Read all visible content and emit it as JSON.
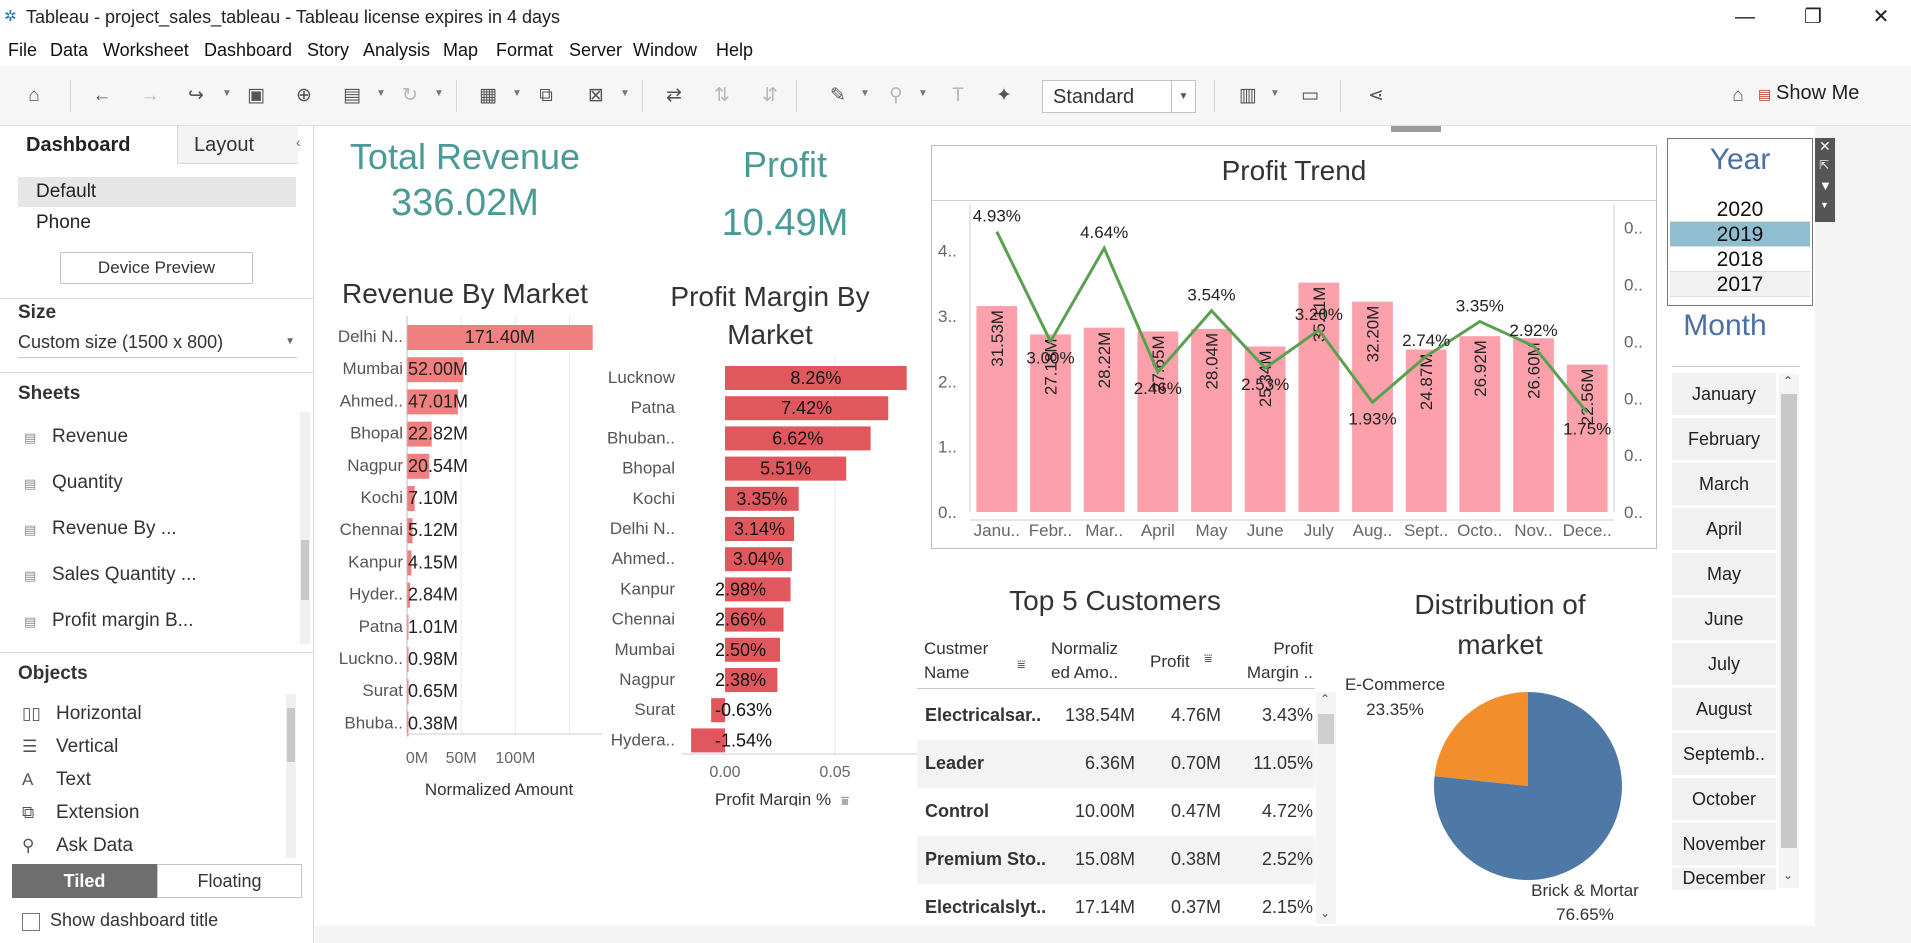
{
  "window": {
    "title": "Tableau - project_sales_tableau - Tableau license expires in 4 days",
    "minimize": "—",
    "restore": "❐",
    "close": "✕"
  },
  "menu": [
    "File",
    "Data",
    "Worksheet",
    "Dashboard",
    "Story",
    "Analysis",
    "Map",
    "Format",
    "Server",
    "Window",
    "Help"
  ],
  "toolbar": {
    "fit_mode": "Standard",
    "show_me": "Show Me"
  },
  "left_pane": {
    "tabs": {
      "dashboard": "Dashboard",
      "layout": "Layout"
    },
    "devices": [
      "Default",
      "Phone"
    ],
    "device_preview": "Device Preview",
    "size_header": "Size",
    "size_value": "Custom size (1500 x 800)",
    "sheets_header": "Sheets",
    "sheets": [
      "Revenue",
      "Quantity",
      "Revenue By ...",
      "Sales Quantity ...",
      "Profit margin B..."
    ],
    "objects_header": "Objects",
    "objects": [
      "Horizontal",
      "Vertical",
      "Text",
      "Extension",
      "Ask Data"
    ],
    "tiled": "Tiled",
    "floating": "Floating",
    "show_title": "Show dashboard title"
  },
  "kpis": {
    "total_revenue_label": "Total Revenue",
    "total_revenue_value": "336.02M",
    "profit_label": "Profit",
    "profit_value": "10.49M"
  },
  "titles": {
    "revenue_by_market": "Revenue By Market",
    "profit_margin_line1": "Profit Margin By",
    "profit_margin_line2": "Market",
    "profit_trend": "Profit Trend",
    "top_customers": "Top 5 Customers",
    "distribution_line1": "Distribution of",
    "distribution_line2": "market"
  },
  "customers_table": {
    "headers": {
      "name_1": "Custmer",
      "name_2": "Name",
      "amount_1": "Normaliz",
      "amount_2": "ed Amo..",
      "profit": "Profit",
      "margin_1": "Profit",
      "margin_2": "Margin .."
    },
    "rows": [
      {
        "name": "Electricalsar..",
        "amount": "138.54M",
        "profit": "4.76M",
        "margin": "3.43%"
      },
      {
        "name": "Leader",
        "amount": "6.36M",
        "profit": "0.70M",
        "margin": "11.05%"
      },
      {
        "name": "Control",
        "amount": "10.00M",
        "profit": "0.47M",
        "margin": "4.72%"
      },
      {
        "name": "Premium Sto..",
        "amount": "15.08M",
        "profit": "0.38M",
        "margin": "2.52%"
      },
      {
        "name": "Electricalslyt..",
        "amount": "17.14M",
        "profit": "0.37M",
        "margin": "2.15%"
      }
    ]
  },
  "filters": {
    "year_title": "Year",
    "years": [
      "2020",
      "2019",
      "2018",
      "2017"
    ],
    "year_selected": "2019",
    "month_title": "Month",
    "months": [
      "January",
      "February",
      "March",
      "April",
      "May",
      "June",
      "July",
      "August",
      "Septemb..",
      "October",
      "November",
      "December"
    ]
  },
  "colors": {
    "kpi": "#4a9a96",
    "revenue_bar": "#f08080",
    "margin_bar": "#e0575e",
    "trend_bar": "#fca1ab",
    "trend_line": "#59a14f",
    "pie_ecommerce": "#f28e2b",
    "pie_brick": "#4e79a7",
    "year_selected": "#8fbfcf"
  },
  "chart_data": [
    {
      "type": "bar",
      "orientation": "horizontal",
      "title": "Revenue By Market",
      "xlabel": "Normalized Amount",
      "x_ticks": [
        "0M",
        "50M",
        "100M"
      ],
      "categories": [
        "Delhi N..",
        "Mumbai",
        "Ahmed..",
        "Bhopal",
        "Nagpur",
        "Kochi",
        "Chennai",
        "Kanpur",
        "Hyder..",
        "Patna",
        "Luckno..",
        "Surat",
        "Bhuba.."
      ],
      "values": [
        171.4,
        52.0,
        47.01,
        22.82,
        20.54,
        7.1,
        5.12,
        4.15,
        2.84,
        1.01,
        0.98,
        0.65,
        0.38
      ],
      "labels": [
        "171.40M",
        "52.00M",
        "47.01M",
        "22.82M",
        "20.54M",
        "7.10M",
        "5.12M",
        "4.15M",
        "2.84M",
        "1.01M",
        "0.98M",
        "0.65M",
        "0.38M"
      ],
      "xlim": [
        0,
        180
      ]
    },
    {
      "type": "bar",
      "orientation": "horizontal",
      "title": "Profit Margin By Market",
      "xlabel": "Profit Margin %",
      "x_ticks": [
        "0.00",
        "0.05"
      ],
      "categories": [
        "Lucknow",
        "Patna",
        "Bhuban..",
        "Bhopal",
        "Kochi",
        "Delhi N..",
        "Ahmed..",
        "Kanpur",
        "Chennai",
        "Mumbai",
        "Nagpur",
        "Surat",
        "Hydera.."
      ],
      "values": [
        0.0826,
        0.0742,
        0.0662,
        0.0551,
        0.0335,
        0.0314,
        0.0304,
        0.0298,
        0.0266,
        0.025,
        0.0238,
        -0.0063,
        -0.0154
      ],
      "labels": [
        "8.26%",
        "7.42%",
        "6.62%",
        "5.51%",
        "3.35%",
        "3.14%",
        "3.04%",
        "2.98%",
        "2.66%",
        "2.50%",
        "2.38%",
        "-0.63%",
        "-1.54%"
      ],
      "xlim": [
        -0.02,
        0.09
      ]
    },
    {
      "type": "bar",
      "title": "Profit Trend",
      "categories": [
        "Janu..",
        "Febr..",
        "Mar..",
        "April",
        "May",
        "June",
        "July",
        "Aug..",
        "Sept..",
        "Octo..",
        "Nov..",
        "Dece.."
      ],
      "y_ticks": [
        "0..",
        "1..",
        "2..",
        "3..",
        "4.."
      ],
      "y2_ticks": [
        "0..",
        "0..",
        "0..",
        "0..",
        "0..",
        "0.."
      ],
      "series": [
        {
          "type": "bar",
          "values": [
            31.53,
            27.18,
            28.22,
            27.65,
            28.04,
            25.34,
            35.11,
            32.2,
            24.87,
            26.92,
            26.6,
            22.56
          ],
          "labels": [
            "31.53M",
            "27.18M",
            "28.22M",
            "27.65M",
            "28.04M",
            "25.34M",
            "35.11M",
            "32.20M",
            "24.87M",
            "26.92M",
            "26.60M",
            "22.56M"
          ]
        },
        {
          "type": "line",
          "values": [
            4.93,
            3.0,
            4.64,
            2.46,
            3.54,
            2.53,
            3.2,
            1.93,
            2.74,
            3.35,
            2.92,
            1.75
          ],
          "labels": [
            "4.93%",
            "3.00%",
            "4.64%",
            "2.46%",
            "3.54%",
            "2.53%",
            "3.20%",
            "1.93%",
            "2.74%",
            "3.35%",
            "2.92%",
            "1.75%"
          ]
        }
      ],
      "ylim": [
        0,
        47
      ],
      "y2lim": [
        0,
        5.4
      ]
    },
    {
      "type": "pie",
      "title": "Distribution of market",
      "categories": [
        "E-Commerce",
        "Brick & Mortar"
      ],
      "values": [
        23.35,
        76.65
      ],
      "labels": [
        "23.35%",
        "76.65%"
      ]
    }
  ]
}
